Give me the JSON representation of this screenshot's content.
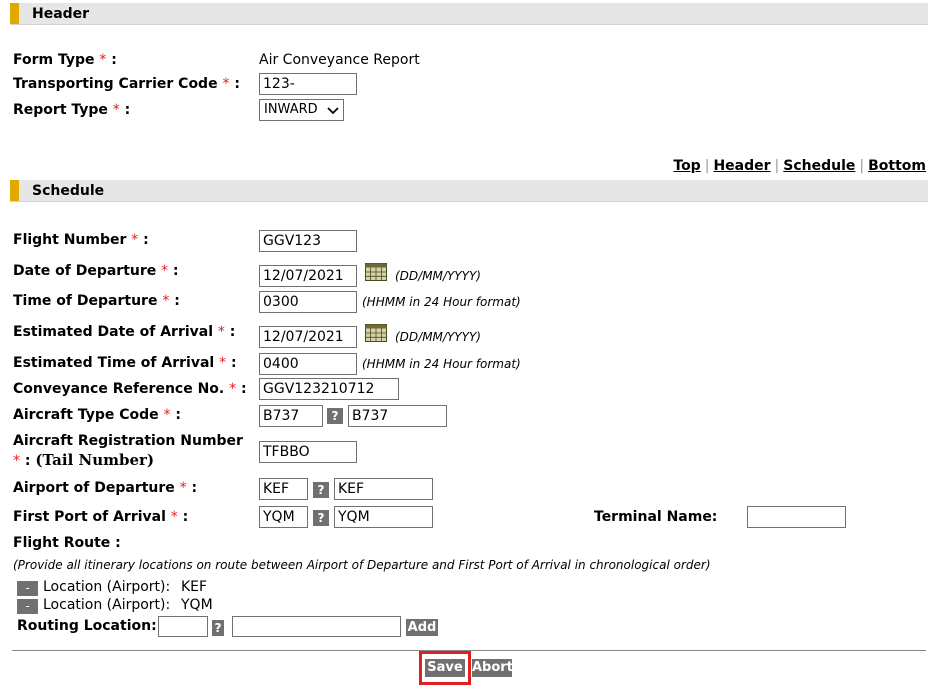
{
  "colors": {
    "accent": "#e3a800",
    "button_gray": "#707070",
    "required": "#dd2222",
    "highlight": "#e02020"
  },
  "header": {
    "title": "Header"
  },
  "form_type": {
    "label": "Form Type",
    "value": "Air Conveyance Report"
  },
  "carrier_code": {
    "label": "Transporting Carrier Code",
    "value": "123-"
  },
  "report_type": {
    "label": "Report Type",
    "value": "INWARD"
  },
  "nav": {
    "top": "Top",
    "header": "Header",
    "schedule": "Schedule",
    "bottom": "Bottom",
    "sep": "|"
  },
  "schedule": {
    "title": "Schedule",
    "flight_number": {
      "label": "Flight Number",
      "value": "GGV123"
    },
    "date_departure": {
      "label": "Date of Departure",
      "value": "12/07/2021",
      "hint": "(DD/MM/YYYY)"
    },
    "time_departure": {
      "label": "Time of Departure",
      "value": "0300",
      "hint": "(HHMM in 24 Hour format)"
    },
    "est_date_arrival": {
      "label": "Estimated Date of Arrival",
      "value": "12/07/2021",
      "hint": "(DD/MM/YYYY)"
    },
    "est_time_arrival": {
      "label": "Estimated Time of Arrival",
      "value": "0400",
      "hint": "(HHMM in 24 Hour format)"
    },
    "conveyance_ref": {
      "label": "Conveyance Reference No.",
      "value": "GGV123210712"
    },
    "aircraft_type": {
      "label": "Aircraft Type Code",
      "code": "B737",
      "desc": "B737"
    },
    "aircraft_reg": {
      "label_line1": "Aircraft Registration Number",
      "label_line2": "(Tail Number)",
      "value": "TFBBO"
    },
    "airport_departure": {
      "label": "Airport of Departure",
      "code": "KEF",
      "desc": "KEF"
    },
    "first_port": {
      "label": "First Port of Arrival",
      "code": "YQM",
      "desc": "YQM"
    },
    "terminal": {
      "label": "Terminal Name:",
      "value": ""
    },
    "flight_route": {
      "label": "Flight Route :",
      "note": "(Provide all itinerary locations on route between Airport of Departure and First Port of Arrival in chronological order)",
      "locations": [
        {
          "label": "Location (Airport):",
          "code": "KEF"
        },
        {
          "label": "Location (Airport):",
          "code": "YQM"
        }
      ],
      "routing_label": "Routing Location:",
      "add_label": "Add"
    }
  },
  "symbols": {
    "required": "*",
    "colon": ":",
    "question": "?",
    "minus": "-"
  },
  "buttons": {
    "save": "Save",
    "abort": "Abort"
  }
}
